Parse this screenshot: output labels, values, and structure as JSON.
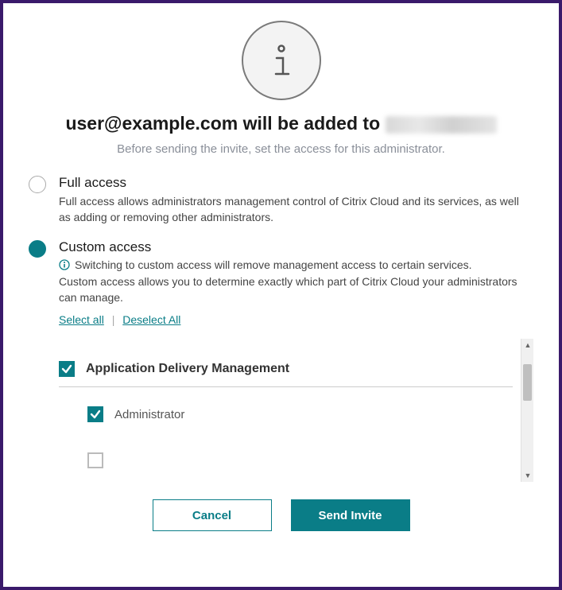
{
  "heading": {
    "prefix": "user@example.com will be added to "
  },
  "subheading": "Before sending the invite, set the access for this administrator.",
  "options": {
    "full": {
      "label": "Full access",
      "desc": "Full access allows administrators management control of Citrix Cloud and its services, as well as adding or removing other administrators.",
      "selected": false
    },
    "custom": {
      "label": "Custom access",
      "note": "Switching to custom access will remove management access to certain services.",
      "desc": "Custom access allows you to determine exactly which part of Citrix Cloud your administrators can manage.",
      "selected": true
    }
  },
  "links": {
    "select_all": "Select all",
    "deselect_all": "Deselect All"
  },
  "permissions": {
    "group_label": "Application Delivery Management",
    "group_checked": true,
    "sub_label": "Administrator",
    "sub_checked": true
  },
  "buttons": {
    "cancel": "Cancel",
    "send": "Send Invite"
  },
  "colors": {
    "accent": "#0a7d87",
    "border": "#3a1a6b"
  }
}
